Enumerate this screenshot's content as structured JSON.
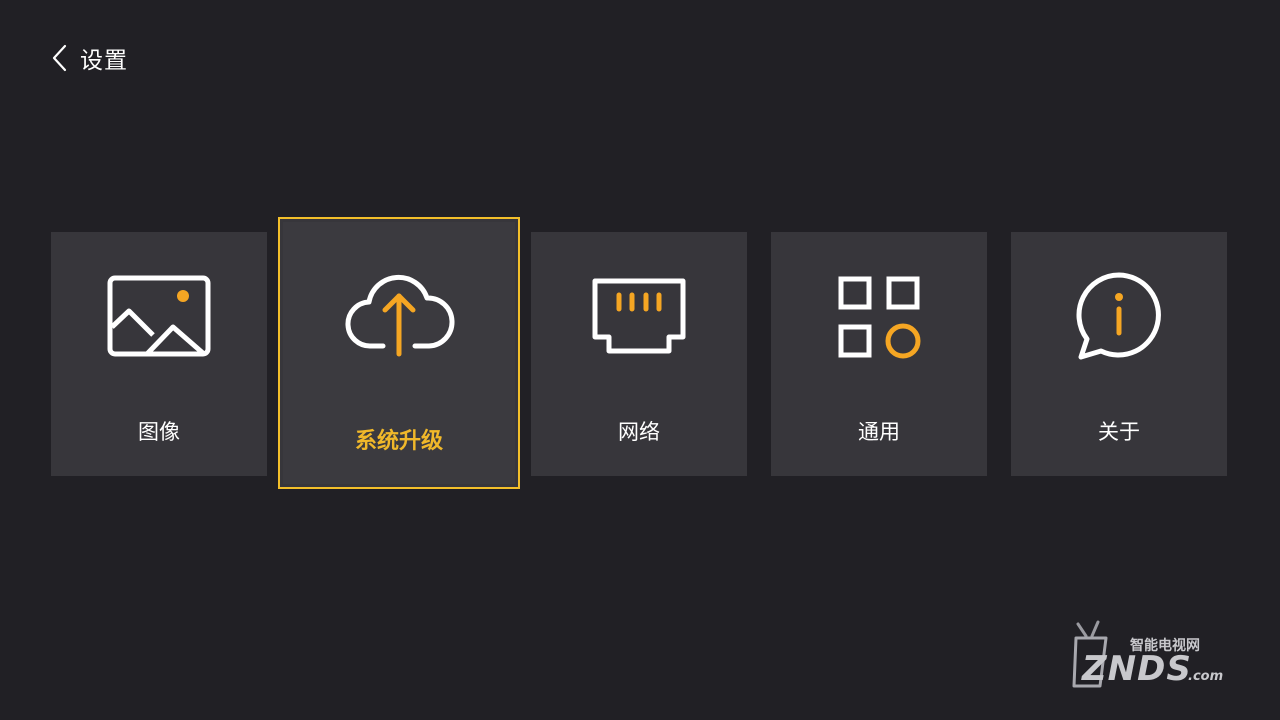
{
  "header": {
    "title": "设置",
    "back_icon": "chevron-left-icon"
  },
  "tiles": [
    {
      "label": "图像",
      "icon": "picture-icon"
    },
    {
      "label": "系统升级",
      "icon": "cloud-upload-icon",
      "focused": true
    },
    {
      "label": "网络",
      "icon": "ethernet-port-icon"
    },
    {
      "label": "通用",
      "icon": "apps-grid-icon"
    },
    {
      "label": "关于",
      "icon": "info-bubble-icon"
    }
  ],
  "watermark": {
    "brand": "ZNDS",
    "suffix": ".com",
    "tagline": "智能电视网"
  },
  "colors": {
    "background": "#212025",
    "tile": "#37363b",
    "accent": "#f5a623",
    "focus_border": "#f3bf2a",
    "focus_label": "#f0b82a"
  }
}
